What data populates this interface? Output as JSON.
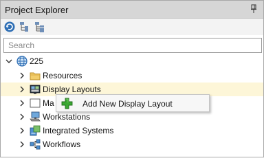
{
  "panel": {
    "title": "Project Explorer",
    "pin_icon": "pin-icon"
  },
  "toolbar": {
    "buttons": [
      {
        "icon": "refresh-icon"
      },
      {
        "icon": "collapse-tree-icon"
      },
      {
        "icon": "expand-tree-icon"
      }
    ]
  },
  "search": {
    "placeholder": "Search",
    "value": ""
  },
  "tree": {
    "root": {
      "label": "225",
      "icon": "globe-icon",
      "expanded": true
    },
    "items": [
      {
        "label": "Resources",
        "icon": "folder-icon"
      },
      {
        "label": "Display Layouts",
        "icon": "display-layouts-icon",
        "selected": true
      },
      {
        "label": "Ma",
        "icon": "map-icon"
      },
      {
        "label": "Workstations",
        "icon": "workstation-icon"
      },
      {
        "label": "Integrated Systems",
        "icon": "integrated-systems-icon"
      },
      {
        "label": "Workflows",
        "icon": "workflows-icon"
      }
    ]
  },
  "context_menu": {
    "items": [
      {
        "label": "Add New Display Layout",
        "icon": "add-plus-icon"
      }
    ]
  },
  "colors": {
    "titlebar": "#d6d6d6",
    "selection": "#fdf6d8",
    "plus_green": "#3aa832",
    "globe_blue": "#2f6fb5",
    "folder_yellow": "#e8b84a"
  }
}
